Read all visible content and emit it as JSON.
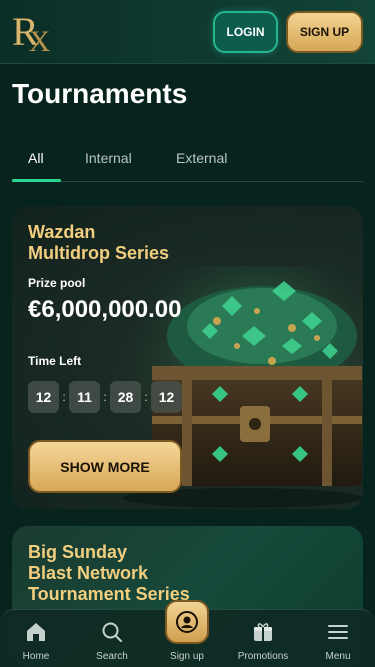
{
  "header": {
    "logo_text": "R",
    "logo_mark": "X",
    "login_label": "LOGIN",
    "signup_label": "SIGN UP"
  },
  "page": {
    "title": "Tournaments"
  },
  "tabs": [
    {
      "label": "All",
      "active": true
    },
    {
      "label": "Internal",
      "active": false
    },
    {
      "label": "External",
      "active": false
    }
  ],
  "cards": [
    {
      "title_line1": "Wazdan",
      "title_line2": "Multidrop Series",
      "prize_label": "Prize pool",
      "prize_value": "€6,000,000.00",
      "time_label": "Time Left",
      "timer": [
        "12",
        "11",
        "28",
        "12"
      ],
      "timer_sep": ":",
      "button_label": "SHOW MORE",
      "image": "treasure-chest-emeralds"
    },
    {
      "title_line1": "Big Sunday",
      "title_line2": "Blast Network",
      "title_line3": "Tournament Series"
    }
  ],
  "bottom_nav": [
    {
      "label": "Home",
      "icon": "home-icon"
    },
    {
      "label": "Search",
      "icon": "search-icon"
    },
    {
      "label": "Sign up",
      "icon": "user-icon"
    },
    {
      "label": "Promotions",
      "icon": "gift-icon"
    },
    {
      "label": "Menu",
      "icon": "menu-icon"
    }
  ],
  "colors": {
    "background": "#07231d",
    "accent_gold": "#f2cf7e",
    "accent_green": "#2bd58f",
    "login_border": "#27b58e"
  }
}
